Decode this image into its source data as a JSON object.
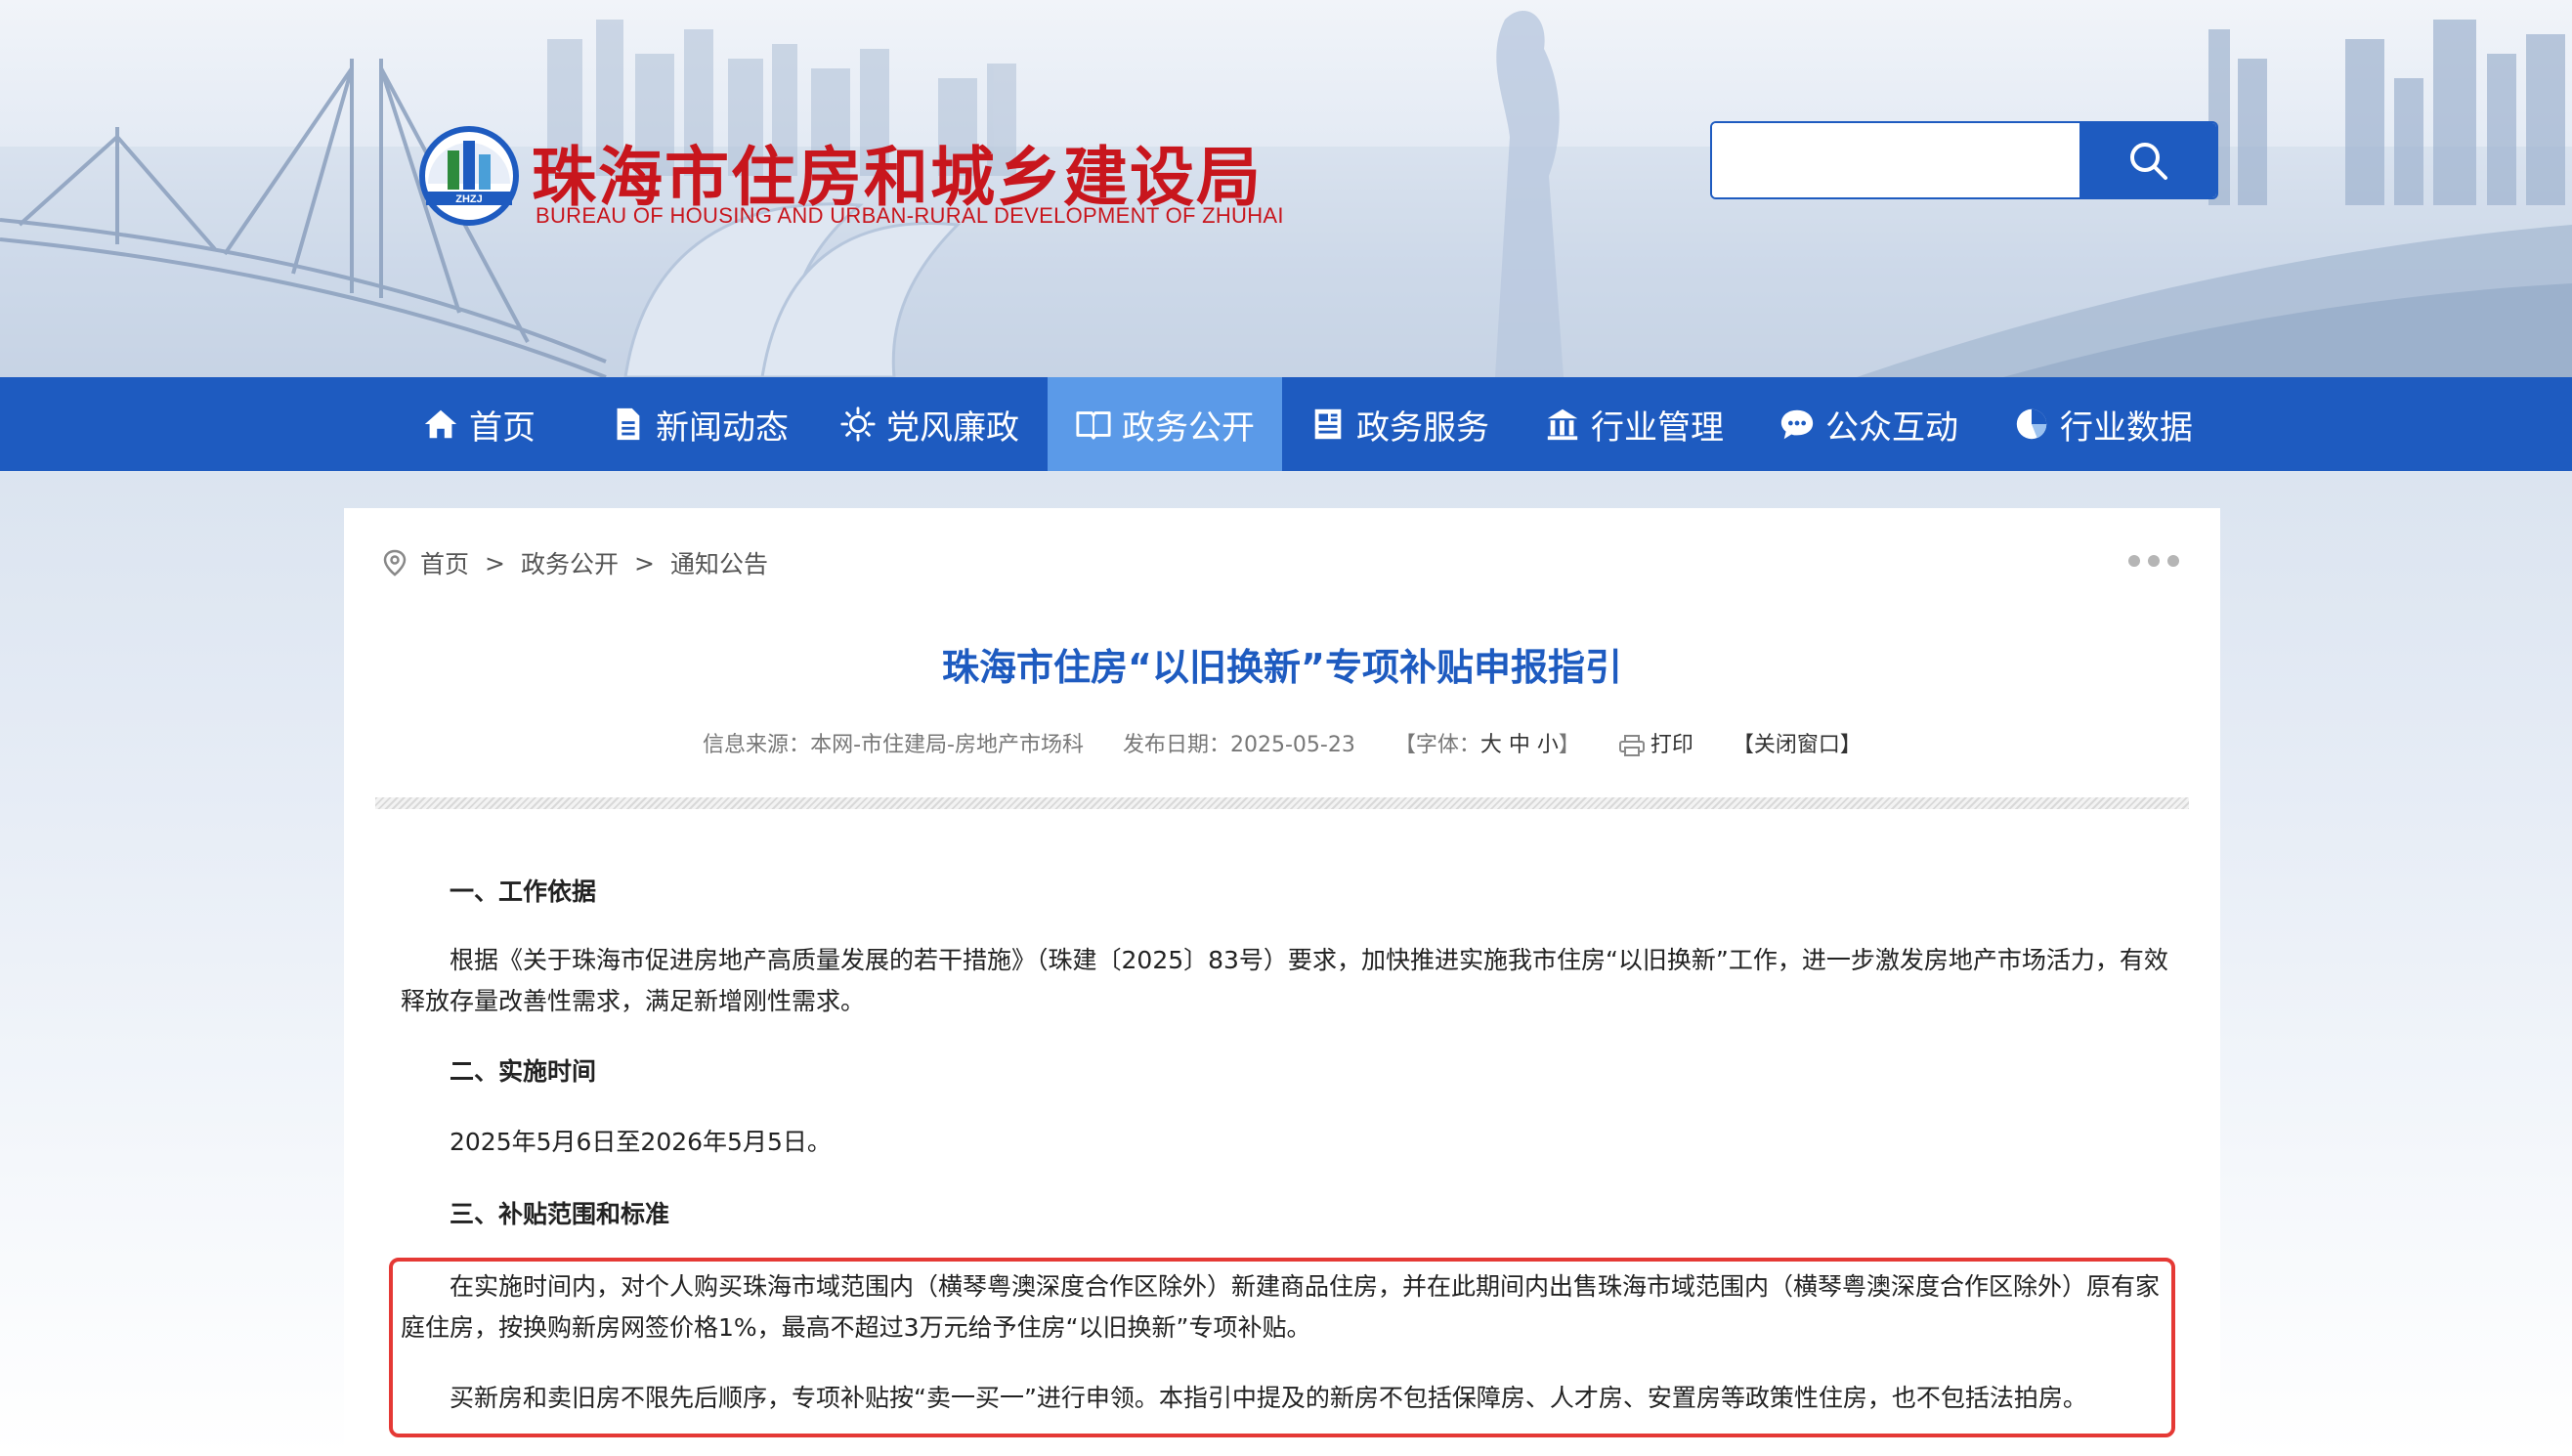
{
  "header": {
    "logo_emblem_text": "ZHZJ",
    "title_cn": "珠海市住房和城乡建设局",
    "title_en": "BUREAU OF HOUSING AND URBAN-RURAL DEVELOPMENT OF ZHUHAI",
    "search": {
      "value": "",
      "placeholder": ""
    },
    "colors": {
      "brand_red": "#c8161d",
      "brand_blue": "#1e5bc0",
      "nav_active": "#5b9ae8"
    }
  },
  "nav": {
    "items": [
      {
        "label": "首页",
        "icon": "home-icon"
      },
      {
        "label": "新闻动态",
        "icon": "document-icon"
      },
      {
        "label": "党风廉政",
        "icon": "sun-gear-icon"
      },
      {
        "label": "政务公开",
        "icon": "open-book-icon",
        "active": true
      },
      {
        "label": "政务服务",
        "icon": "newspaper-icon"
      },
      {
        "label": "行业管理",
        "icon": "building-columns-icon"
      },
      {
        "label": "公众互动",
        "icon": "chat-bubble-icon"
      },
      {
        "label": "行业数据",
        "icon": "pie-chart-icon"
      }
    ]
  },
  "breadcrumb": {
    "items": [
      "首页",
      "政务公开",
      "通知公告"
    ],
    "separator": ">"
  },
  "article": {
    "title": "珠海市住房“以旧换新”专项补贴申报指引",
    "meta": {
      "source_label": "信息来源：",
      "source": "本网-市住建局-房地产市场科",
      "date_label": "发布日期：",
      "date": "2025-05-23",
      "font_label": "【字体：",
      "font_large": "大",
      "font_medium": "中",
      "font_small": "小",
      "font_close": "】",
      "print": "打印",
      "close_window": "【关闭窗口】"
    },
    "sections": {
      "h1": "一、工作依据",
      "p1": "根据《关于珠海市促进房地产高质量发展的若干措施》（珠建〔2025〕83号）要求，加快推进实施我市住房“以旧换新”工作，进一步激发房地产市场活力，有效释放存量改善性需求，满足新增刚性需求。",
      "h2": "二、实施时间",
      "p2": "2025年5月6日至2026年5月5日。",
      "h3": "三、补贴范围和标准",
      "p3": "在实施时间内，对个人购买珠海市域范围内（横琴粤澳深度合作区除外）新建商品住房，并在此期间内出售珠海市域范围内（横琴粤澳深度合作区除外）原有家庭住房，按换购新房网签价格1%，最高不超过3万元给予住房“以旧换新”专项补贴。",
      "p4": "买新房和卖旧房不限先后顺序，专项补贴按“卖一买一”进行申领。本指引中提及的新房不包括保障房、人才房、安置房等政策性住房，也不包括法拍房。"
    }
  }
}
